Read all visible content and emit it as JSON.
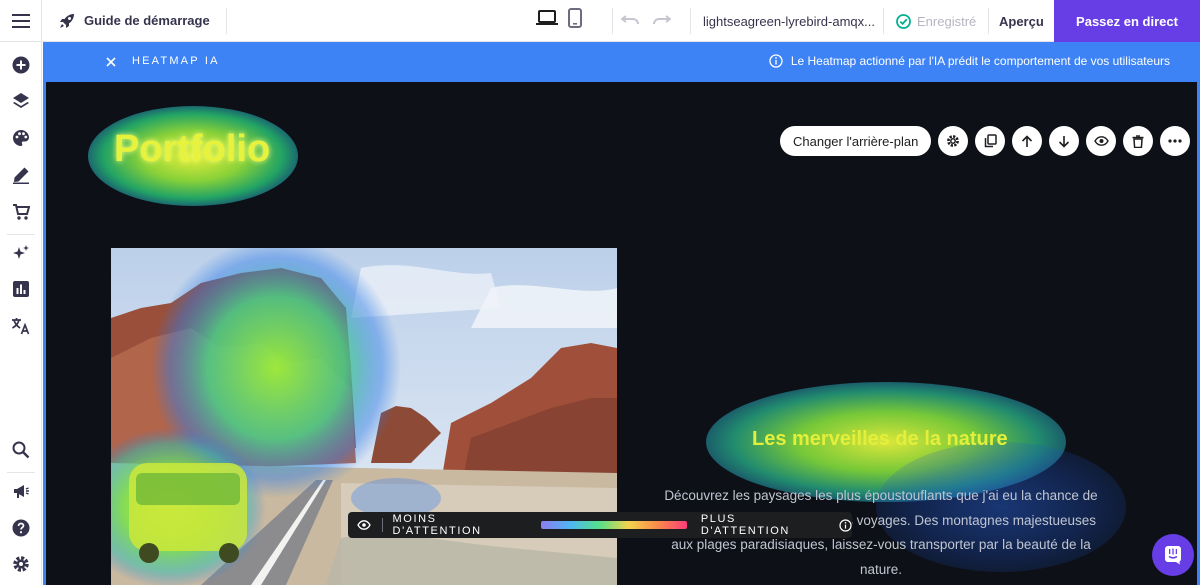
{
  "topbar": {
    "guide_label": "Guide de démarrage",
    "url": "lightseagreen-lyrebird-amqx...",
    "saved_label": "Enregistré",
    "preview_label": "Aperçu",
    "publish_label": "Passez en direct"
  },
  "sidebar": {
    "items": [
      "add-icon",
      "layers-icon",
      "palette-icon",
      "edit-icon",
      "cart-icon",
      "ai-sparkle-icon",
      "analytics-icon",
      "translate-icon",
      "search-icon",
      "megaphone-icon",
      "help-icon",
      "settings-icon"
    ]
  },
  "banner": {
    "title": "HEATMAP IA",
    "info": "Le Heatmap actionné par l'IA prédit le comportement de vos utilisateurs"
  },
  "site": {
    "title": "Portfolio",
    "change_background_label": "Changer l'arrière-plan",
    "section_title": "Les merveilles de la nature",
    "paragraph": "Découvrez les paysages les plus époustouflants que j'ai eu la chance de photographier au cours de mes voyages. Des montagnes majestueuses aux plages paradisiaques, laissez-vous transporter par la beauté de la nature."
  },
  "legend": {
    "less_label": "MOINS D'ATTENTION",
    "more_label": "PLUS D'ATTENTION"
  },
  "colors": {
    "accent": "#673de6",
    "banner": "#3d83f5",
    "canvas": "#0d1117",
    "heat_yellow": "#e7f23c"
  }
}
